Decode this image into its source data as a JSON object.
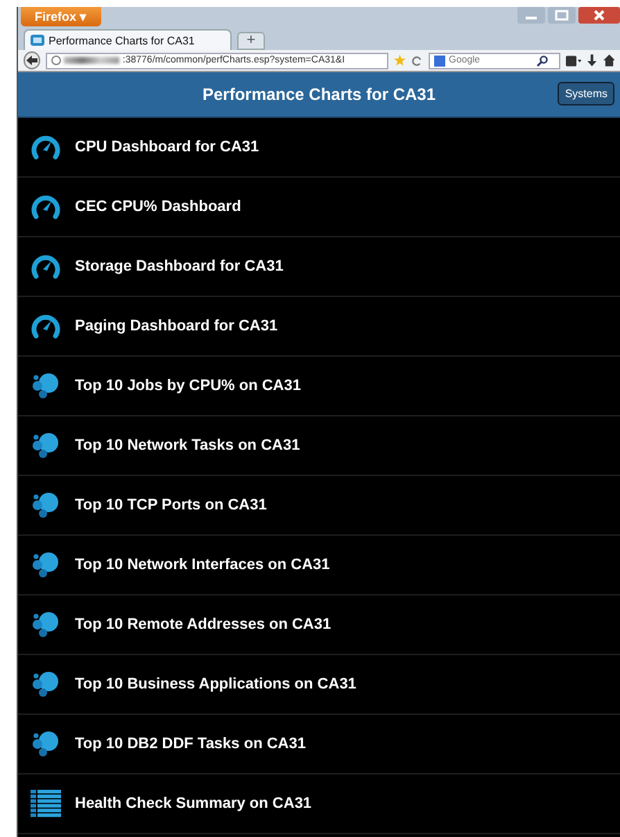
{
  "browser": {
    "menu_button": "Firefox ▾",
    "tab_title": "Performance Charts for CA31",
    "new_tab": "+",
    "url": ":38776/m/common/perfCharts.esp?system=CA31&I",
    "search": {
      "placeholder": "Google"
    }
  },
  "header": {
    "title": "Performance Charts for CA31",
    "button": "Systems"
  },
  "items": [
    {
      "kind": "gauge",
      "label": "CPU Dashboard for CA31"
    },
    {
      "kind": "gauge",
      "label": "CEC CPU% Dashboard"
    },
    {
      "kind": "gauge",
      "label": "Storage Dashboard for CA31"
    },
    {
      "kind": "gauge",
      "label": "Paging Dashboard for CA31"
    },
    {
      "kind": "bubbles",
      "label": "Top 10 Jobs by CPU% on CA31"
    },
    {
      "kind": "bubbles",
      "label": "Top 10 Network Tasks on CA31"
    },
    {
      "kind": "bubbles",
      "label": "Top 10 TCP Ports on CA31"
    },
    {
      "kind": "bubbles",
      "label": "Top 10 Network Interfaces on CA31"
    },
    {
      "kind": "bubbles",
      "label": "Top 10 Remote Addresses on CA31"
    },
    {
      "kind": "bubbles",
      "label": "Top 10 Business Applications on CA31"
    },
    {
      "kind": "bubbles",
      "label": "Top 10 DB2 DDF Tasks on CA31"
    },
    {
      "kind": "table",
      "label": "Health Check Summary on CA31"
    }
  ]
}
